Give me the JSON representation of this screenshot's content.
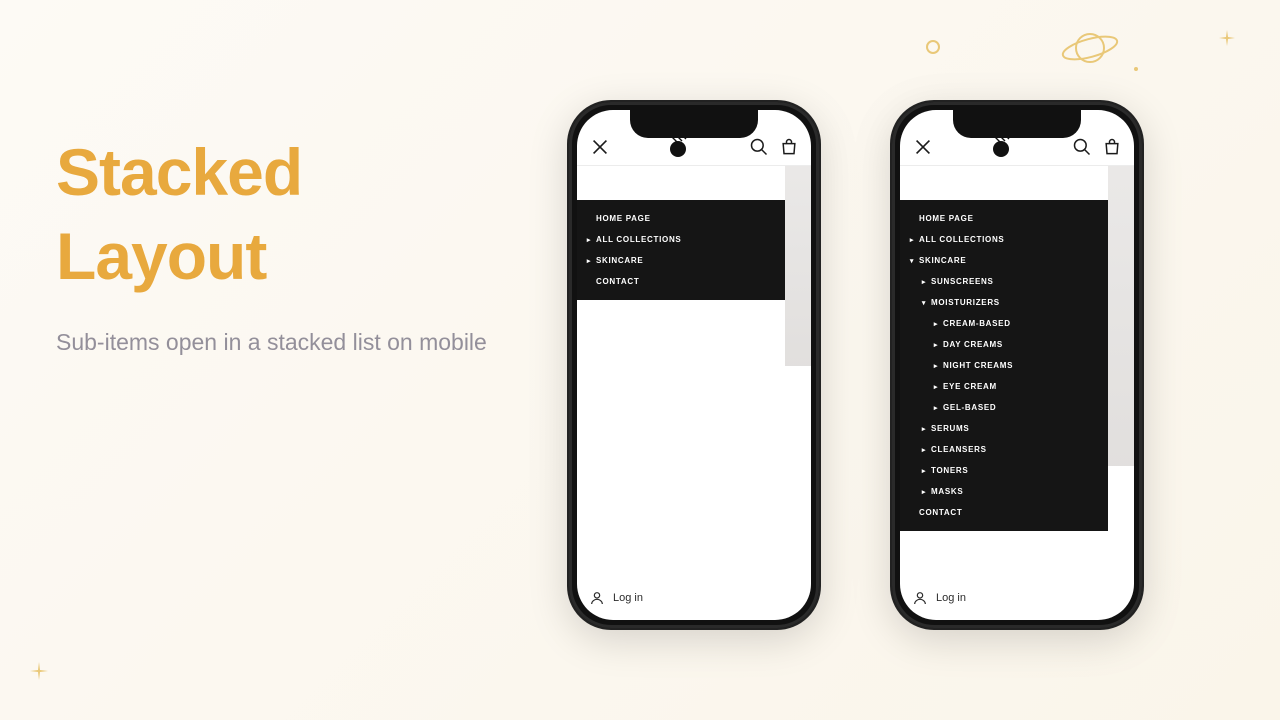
{
  "heading": {
    "title_line1": "Stacked",
    "title_line2": "Layout",
    "subtitle": "Sub-items open in a stacked list on mobile"
  },
  "phone1": {
    "menu": {
      "home": "HOME PAGE",
      "all_collections": "ALL COLLECTIONS",
      "skincare": "SKINCARE",
      "contact": "CONTACT"
    },
    "login": "Log in"
  },
  "phone2": {
    "menu": {
      "home": "HOME PAGE",
      "all_collections": "ALL COLLECTIONS",
      "skincare": "SKINCARE",
      "sunscreens": "SUNSCREENS",
      "moisturizers": "MOISTURIZERS",
      "cream_based": "CREAM-BASED",
      "day_creams": "DAY CREAMS",
      "night_creams": "NIGHT CREAMS",
      "eye_cream": "EYE CREAM",
      "gel_based": "GEL-BASED",
      "serums": "SERUMS",
      "cleansers": "CLEANSERS",
      "toners": "TONERS",
      "masks": "MASKS",
      "contact": "CONTACT"
    },
    "login": "Log in"
  }
}
